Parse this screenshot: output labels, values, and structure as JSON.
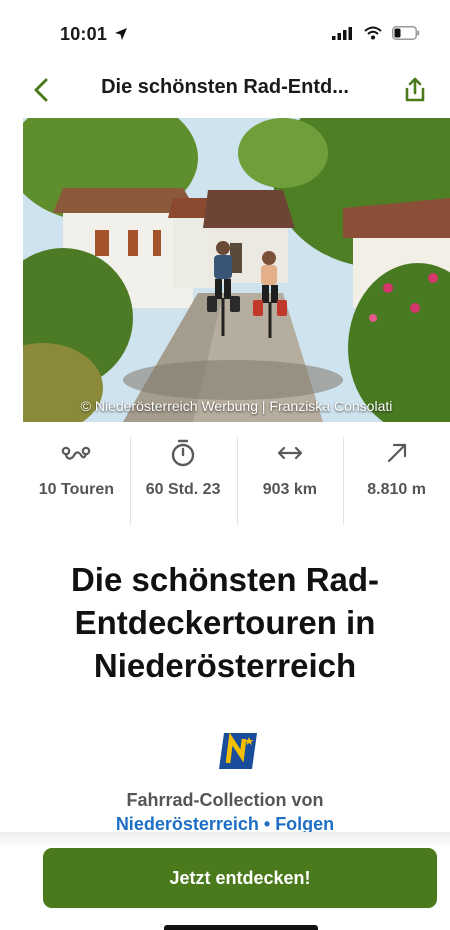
{
  "status_bar": {
    "time": "10:01",
    "location_icon": "location-arrow-icon",
    "signal_icon": "cellular-signal-icon",
    "wifi_icon": "wifi-icon",
    "battery_icon": "battery-icon",
    "battery_level": 0.3
  },
  "nav": {
    "back_icon": "chevron-left-icon",
    "title": "Die schönsten Rad-Entd...",
    "share_icon": "share-icon"
  },
  "hero": {
    "image_label": "hero-photo",
    "credit": "© Niederösterreich Werbung | Franziska Consolati"
  },
  "stats": [
    {
      "icon": "tours-icon",
      "value": "10 Touren"
    },
    {
      "icon": "stopwatch-icon",
      "value": "60 Std. 23"
    },
    {
      "icon": "distance-arrows-icon",
      "value": "903 km"
    },
    {
      "icon": "ascent-arrow-icon",
      "value": "8.810 m"
    }
  ],
  "title": "Die schönsten Rad-Entdeckertouren in Niederösterreich",
  "collection": {
    "logo_icon": "niederoesterreich-logo-icon",
    "by_label": "Fahrrad-Collection von",
    "author": "Niederösterreich",
    "separator": "•",
    "follow": "Folgen"
  },
  "cta": {
    "label": "Jetzt entdecken!"
  },
  "colors": {
    "accent_green": "#4a7a1c",
    "link_blue": "#1e6fc4",
    "text_dark": "#111111",
    "text_gray": "#555555",
    "logo_blue": "#1a4c9c",
    "logo_yellow": "#f3c000"
  }
}
